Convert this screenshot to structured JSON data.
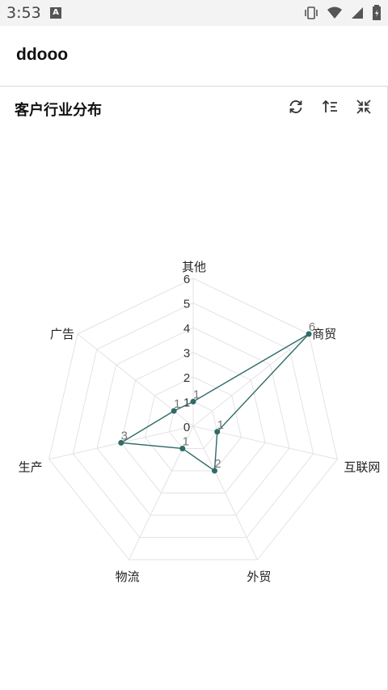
{
  "status": {
    "time": "3:53",
    "notif_icon": "A"
  },
  "app": {
    "title": "ddooo"
  },
  "card": {
    "title": "客户行业分布",
    "icons": [
      "refresh-icon",
      "sort-icon",
      "collapse-icon"
    ]
  },
  "chart_data": {
    "type": "radar",
    "title": "",
    "indicators": [
      "其他",
      "商贸",
      "互联网",
      "外贸",
      "物流",
      "生产",
      "广告"
    ],
    "series": [
      {
        "values": [
          1,
          6,
          1,
          2,
          1,
          3,
          1
        ]
      }
    ],
    "range": [
      0,
      6
    ],
    "ticks": [
      "0",
      "1",
      "2",
      "3",
      "4",
      "5",
      "6"
    ],
    "value_labels": [
      "1",
      "6",
      "1",
      "2",
      "1",
      "3",
      "1"
    ],
    "colors": {
      "line": "#2f6b68",
      "grid": "#e3e3e3",
      "label": "#777777"
    }
  }
}
